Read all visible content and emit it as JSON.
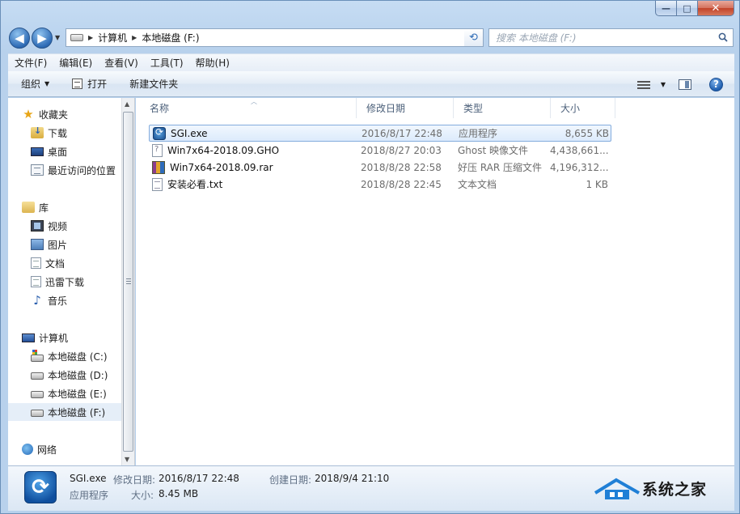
{
  "window": {
    "minimize": "—",
    "maximize": "□",
    "close": "✕"
  },
  "nav": {
    "back": "◀",
    "forward": "▶",
    "breadcrumb": [
      "计算机",
      "本地磁盘 (F:)"
    ],
    "search_placeholder": "搜索 本地磁盘 (F:)"
  },
  "menu": [
    "文件(F)",
    "编辑(E)",
    "查看(V)",
    "工具(T)",
    "帮助(H)"
  ],
  "toolbar": {
    "organize": "组织",
    "open": "打开",
    "new_folder": "新建文件夹",
    "help": "?"
  },
  "sidebar": {
    "favorites": {
      "label": "收藏夹",
      "items": [
        "下载",
        "桌面",
        "最近访问的位置"
      ]
    },
    "libraries": {
      "label": "库",
      "items": [
        "视频",
        "图片",
        "文档",
        "迅雷下载",
        "音乐"
      ]
    },
    "computer": {
      "label": "计算机",
      "items": [
        "本地磁盘 (C:)",
        "本地磁盘 (D:)",
        "本地磁盘 (E:)",
        "本地磁盘 (F:)"
      ],
      "selected": "本地磁盘 (F:)"
    },
    "network": {
      "label": "网络"
    }
  },
  "columns": [
    "名称",
    "修改日期",
    "类型",
    "大小"
  ],
  "files": [
    {
      "name": "SGI.exe",
      "date": "2016/8/17 22:48",
      "type": "应用程序",
      "size": "8,655 KB",
      "icon": "exe-icon",
      "selected": true
    },
    {
      "name": "Win7x64-2018.09.GHO",
      "date": "2018/8/27 20:03",
      "type": "Ghost 映像文件",
      "size": "4,438,661...",
      "icon": "gho-file-icon",
      "selected": false
    },
    {
      "name": "Win7x64-2018.09.rar",
      "date": "2018/8/28 22:58",
      "type": "好压 RAR 压缩文件",
      "size": "4,196,312...",
      "icon": "rar-archive-icon",
      "selected": false
    },
    {
      "name": "安装必看.txt",
      "date": "2018/8/28 22:45",
      "type": "文本文档",
      "size": "1 KB",
      "icon": "text-file-icon",
      "selected": false
    }
  ],
  "details": {
    "name": "SGI.exe",
    "type": "应用程序",
    "modified_label": "修改日期:",
    "modified": "2016/8/17 22:48",
    "size_label": "大小:",
    "size": "8.45 MB",
    "created_label": "创建日期:",
    "created": "2018/9/4 21:10"
  },
  "watermark": "系统之家"
}
